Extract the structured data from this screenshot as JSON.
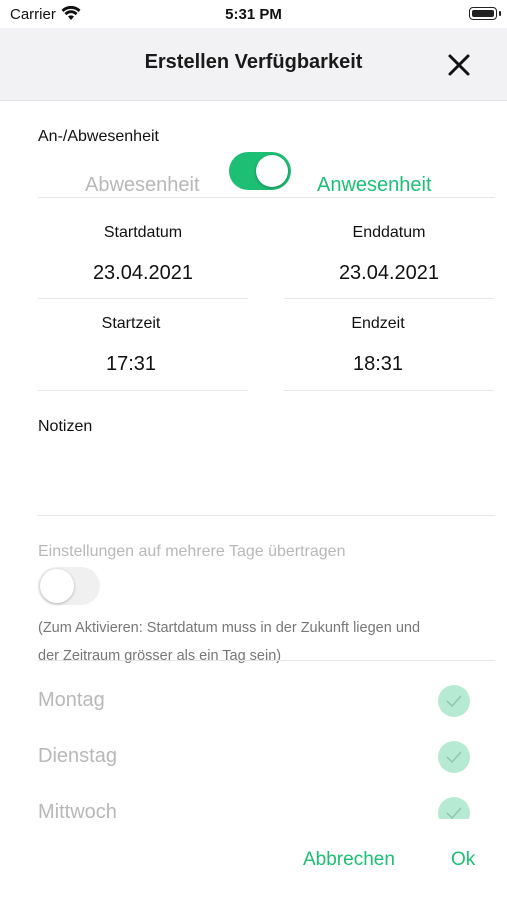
{
  "status": {
    "carrier": "Carrier",
    "time": "5:31 PM"
  },
  "header": {
    "title": "Erstellen Verfügbarkeit",
    "close_icon": "close-icon"
  },
  "presence": {
    "section_label": "An-/Abwesenheit",
    "off_label": "Abwesenheit",
    "on_label": "Anwesenheit",
    "enabled": true
  },
  "dates": {
    "start_date_label": "Startdatum",
    "start_date_value": "23.04.2021",
    "end_date_label": "Enddatum",
    "end_date_value": "23.04.2021",
    "start_time_label": "Startzeit",
    "start_time_value": "17:31",
    "end_time_label": "Endzeit",
    "end_time_value": "18:31"
  },
  "notes": {
    "label": "Notizen",
    "value": ""
  },
  "multi_day": {
    "label": "Einstellungen auf mehrere Tage übertragen",
    "enabled": false,
    "hint_line1": "(Zum Aktivieren: Startdatum muss in der Zukunft liegen und",
    "hint_line2": "der Zeitraum grösser als ein Tag sein)"
  },
  "weekdays": [
    {
      "label": "Montag",
      "checked": true
    },
    {
      "label": "Dienstag",
      "checked": true
    },
    {
      "label": "Mittwoch",
      "checked": true
    }
  ],
  "footer": {
    "cancel_label": "Abbrechen",
    "ok_label": "Ok"
  },
  "colors": {
    "accent": "#1dbf74",
    "muted_text": "#b8b8b8",
    "check_bg": "#b7ead3",
    "nav_bg": "#f2f2f4"
  }
}
